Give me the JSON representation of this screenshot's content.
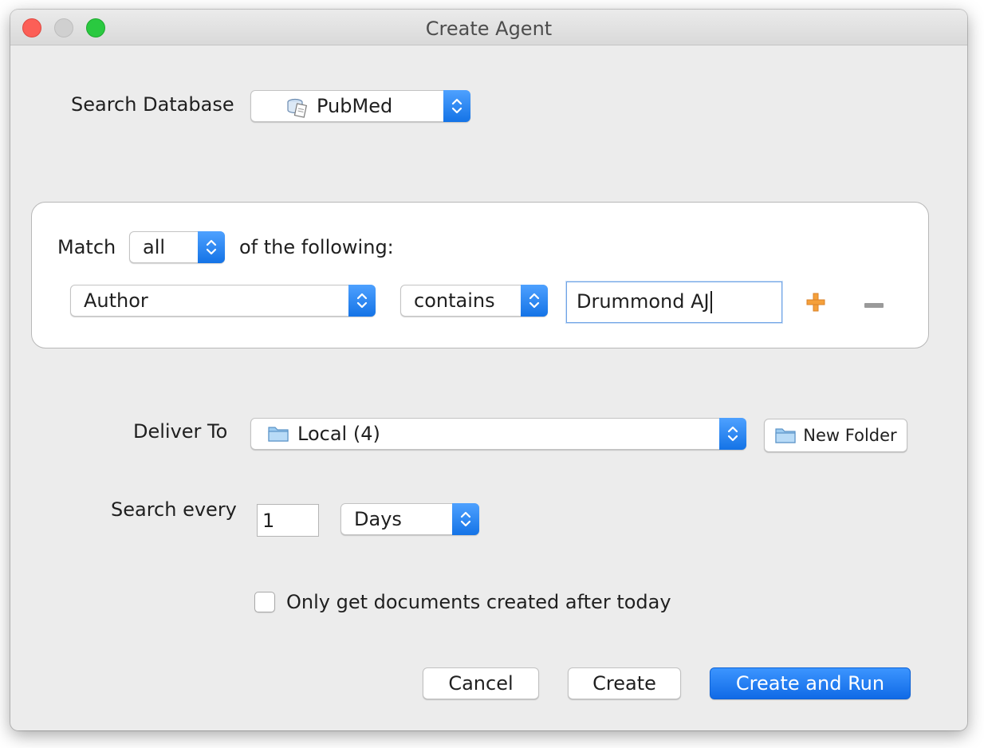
{
  "window": {
    "title": "Create Agent"
  },
  "search_database": {
    "label": "Search Database",
    "selected": "PubMed",
    "icon": "database-document-icon"
  },
  "criteria": {
    "match_label": "Match",
    "match_value": "all",
    "following_label": "of the following:",
    "field": "Author",
    "operator": "contains",
    "value": "Drummond AJ",
    "add_icon": "plus-icon",
    "remove_icon": "minus-icon"
  },
  "deliver_to": {
    "label": "Deliver To",
    "selected": "Local (4)",
    "icon": "folder-icon",
    "new_folder_label": "New Folder"
  },
  "schedule": {
    "label": "Search every",
    "interval_value": "1",
    "unit": "Days"
  },
  "options": {
    "only_new_label": "Only get documents created after today",
    "only_new_checked": false
  },
  "buttons": {
    "cancel": "Cancel",
    "create": "Create",
    "create_and_run": "Create and Run"
  },
  "colors": {
    "accent": "#1473e6",
    "add_icon": "#f5a03a",
    "remove_icon": "#9a9a9a"
  }
}
